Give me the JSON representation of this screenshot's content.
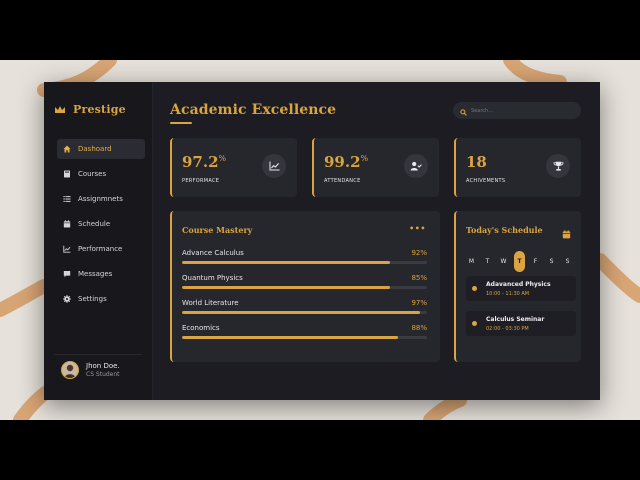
{
  "brand": {
    "name": "Prestige"
  },
  "sidebar": {
    "items": [
      {
        "label": "Dashoard",
        "icon": "home-icon",
        "active": true
      },
      {
        "label": "Courses",
        "icon": "book-icon",
        "active": false
      },
      {
        "label": "Assignmnets",
        "icon": "list-icon",
        "active": false
      },
      {
        "label": "Schedule",
        "icon": "calendar-icon",
        "active": false
      },
      {
        "label": "Performance",
        "icon": "chart-icon",
        "active": false
      },
      {
        "label": "Messages",
        "icon": "chat-icon",
        "active": false
      },
      {
        "label": "Settings",
        "icon": "gear-icon",
        "active": false
      }
    ],
    "user": {
      "name": "Jhon Doe.",
      "role": "CS Student"
    }
  },
  "header": {
    "title": "Academic Excellence",
    "search_placeholder": "Search..."
  },
  "stats": [
    {
      "value": "97.2",
      "unit": "%",
      "label": "PERFORMACE",
      "icon": "trend-chart-icon"
    },
    {
      "value": "99.2",
      "unit": "%",
      "label": "ATTENDANCE",
      "icon": "user-check-icon"
    },
    {
      "value": "18",
      "unit": "",
      "label": "ACHIVEMENTS",
      "icon": "trophy-icon"
    }
  ],
  "mastery": {
    "title": "Course Mastery",
    "more_label": "•••",
    "courses": [
      {
        "name": "Advance Calculus",
        "percent_label": "92%",
        "progress": 0.85
      },
      {
        "name": "Quantum Physics",
        "percent_label": "85%",
        "progress": 0.85
      },
      {
        "name": "World Literature",
        "percent_label": "97%",
        "progress": 0.97
      },
      {
        "name": "Economics",
        "percent_label": "88%",
        "progress": 0.88
      }
    ]
  },
  "schedule": {
    "title": "Today's Schedule",
    "weekdays": [
      "M",
      "T",
      "W",
      "T",
      "F",
      "S",
      "S"
    ],
    "active_day_index": 3,
    "events": [
      {
        "title": "Adavanced Physics",
        "time": "10:00 - 11:30 AM"
      },
      {
        "title": "Calculus Seminar",
        "time": "02:00 - 03:30 PM"
      }
    ]
  },
  "colors": {
    "accent": "#d9a441",
    "panel": "#26262d",
    "sidebar": "#17171c",
    "background": "#1c1c22"
  }
}
